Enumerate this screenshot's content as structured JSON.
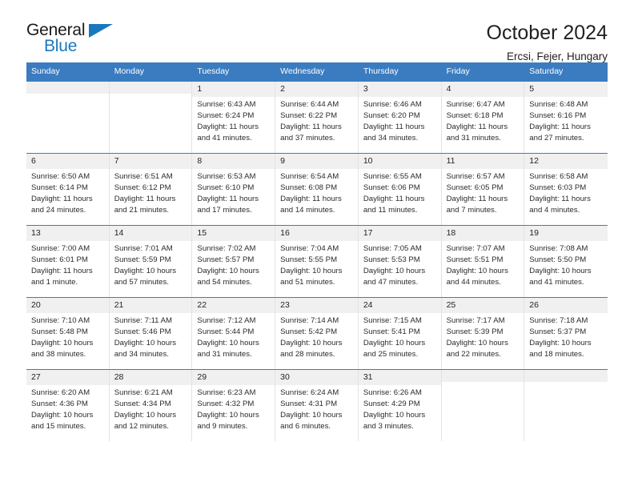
{
  "brand": {
    "name_part1": "General",
    "name_part2": "Blue",
    "flag_icon": "triangle-flag-icon"
  },
  "header": {
    "title": "October 2024",
    "subtitle": "Ercsi, Fejer, Hungary"
  },
  "colors": {
    "header_blue": "#3b7cc0",
    "brand_blue": "#1878be",
    "daynum_band": "#f0f0f0",
    "text": "#231f20"
  },
  "weekday_headers": [
    "Sunday",
    "Monday",
    "Tuesday",
    "Wednesday",
    "Thursday",
    "Friday",
    "Saturday"
  ],
  "weeks": [
    [
      {
        "day": "",
        "sunrise": "",
        "sunset": "",
        "daylight": ""
      },
      {
        "day": "",
        "sunrise": "",
        "sunset": "",
        "daylight": ""
      },
      {
        "day": "1",
        "sunrise": "Sunrise: 6:43 AM",
        "sunset": "Sunset: 6:24 PM",
        "daylight": "Daylight: 11 hours and 41 minutes."
      },
      {
        "day": "2",
        "sunrise": "Sunrise: 6:44 AM",
        "sunset": "Sunset: 6:22 PM",
        "daylight": "Daylight: 11 hours and 37 minutes."
      },
      {
        "day": "3",
        "sunrise": "Sunrise: 6:46 AM",
        "sunset": "Sunset: 6:20 PM",
        "daylight": "Daylight: 11 hours and 34 minutes."
      },
      {
        "day": "4",
        "sunrise": "Sunrise: 6:47 AM",
        "sunset": "Sunset: 6:18 PM",
        "daylight": "Daylight: 11 hours and 31 minutes."
      },
      {
        "day": "5",
        "sunrise": "Sunrise: 6:48 AM",
        "sunset": "Sunset: 6:16 PM",
        "daylight": "Daylight: 11 hours and 27 minutes."
      }
    ],
    [
      {
        "day": "6",
        "sunrise": "Sunrise: 6:50 AM",
        "sunset": "Sunset: 6:14 PM",
        "daylight": "Daylight: 11 hours and 24 minutes."
      },
      {
        "day": "7",
        "sunrise": "Sunrise: 6:51 AM",
        "sunset": "Sunset: 6:12 PM",
        "daylight": "Daylight: 11 hours and 21 minutes."
      },
      {
        "day": "8",
        "sunrise": "Sunrise: 6:53 AM",
        "sunset": "Sunset: 6:10 PM",
        "daylight": "Daylight: 11 hours and 17 minutes."
      },
      {
        "day": "9",
        "sunrise": "Sunrise: 6:54 AM",
        "sunset": "Sunset: 6:08 PM",
        "daylight": "Daylight: 11 hours and 14 minutes."
      },
      {
        "day": "10",
        "sunrise": "Sunrise: 6:55 AM",
        "sunset": "Sunset: 6:06 PM",
        "daylight": "Daylight: 11 hours and 11 minutes."
      },
      {
        "day": "11",
        "sunrise": "Sunrise: 6:57 AM",
        "sunset": "Sunset: 6:05 PM",
        "daylight": "Daylight: 11 hours and 7 minutes."
      },
      {
        "day": "12",
        "sunrise": "Sunrise: 6:58 AM",
        "sunset": "Sunset: 6:03 PM",
        "daylight": "Daylight: 11 hours and 4 minutes."
      }
    ],
    [
      {
        "day": "13",
        "sunrise": "Sunrise: 7:00 AM",
        "sunset": "Sunset: 6:01 PM",
        "daylight": "Daylight: 11 hours and 1 minute."
      },
      {
        "day": "14",
        "sunrise": "Sunrise: 7:01 AM",
        "sunset": "Sunset: 5:59 PM",
        "daylight": "Daylight: 10 hours and 57 minutes."
      },
      {
        "day": "15",
        "sunrise": "Sunrise: 7:02 AM",
        "sunset": "Sunset: 5:57 PM",
        "daylight": "Daylight: 10 hours and 54 minutes."
      },
      {
        "day": "16",
        "sunrise": "Sunrise: 7:04 AM",
        "sunset": "Sunset: 5:55 PM",
        "daylight": "Daylight: 10 hours and 51 minutes."
      },
      {
        "day": "17",
        "sunrise": "Sunrise: 7:05 AM",
        "sunset": "Sunset: 5:53 PM",
        "daylight": "Daylight: 10 hours and 47 minutes."
      },
      {
        "day": "18",
        "sunrise": "Sunrise: 7:07 AM",
        "sunset": "Sunset: 5:51 PM",
        "daylight": "Daylight: 10 hours and 44 minutes."
      },
      {
        "day": "19",
        "sunrise": "Sunrise: 7:08 AM",
        "sunset": "Sunset: 5:50 PM",
        "daylight": "Daylight: 10 hours and 41 minutes."
      }
    ],
    [
      {
        "day": "20",
        "sunrise": "Sunrise: 7:10 AM",
        "sunset": "Sunset: 5:48 PM",
        "daylight": "Daylight: 10 hours and 38 minutes."
      },
      {
        "day": "21",
        "sunrise": "Sunrise: 7:11 AM",
        "sunset": "Sunset: 5:46 PM",
        "daylight": "Daylight: 10 hours and 34 minutes."
      },
      {
        "day": "22",
        "sunrise": "Sunrise: 7:12 AM",
        "sunset": "Sunset: 5:44 PM",
        "daylight": "Daylight: 10 hours and 31 minutes."
      },
      {
        "day": "23",
        "sunrise": "Sunrise: 7:14 AM",
        "sunset": "Sunset: 5:42 PM",
        "daylight": "Daylight: 10 hours and 28 minutes."
      },
      {
        "day": "24",
        "sunrise": "Sunrise: 7:15 AM",
        "sunset": "Sunset: 5:41 PM",
        "daylight": "Daylight: 10 hours and 25 minutes."
      },
      {
        "day": "25",
        "sunrise": "Sunrise: 7:17 AM",
        "sunset": "Sunset: 5:39 PM",
        "daylight": "Daylight: 10 hours and 22 minutes."
      },
      {
        "day": "26",
        "sunrise": "Sunrise: 7:18 AM",
        "sunset": "Sunset: 5:37 PM",
        "daylight": "Daylight: 10 hours and 18 minutes."
      }
    ],
    [
      {
        "day": "27",
        "sunrise": "Sunrise: 6:20 AM",
        "sunset": "Sunset: 4:36 PM",
        "daylight": "Daylight: 10 hours and 15 minutes."
      },
      {
        "day": "28",
        "sunrise": "Sunrise: 6:21 AM",
        "sunset": "Sunset: 4:34 PM",
        "daylight": "Daylight: 10 hours and 12 minutes."
      },
      {
        "day": "29",
        "sunrise": "Sunrise: 6:23 AM",
        "sunset": "Sunset: 4:32 PM",
        "daylight": "Daylight: 10 hours and 9 minutes."
      },
      {
        "day": "30",
        "sunrise": "Sunrise: 6:24 AM",
        "sunset": "Sunset: 4:31 PM",
        "daylight": "Daylight: 10 hours and 6 minutes."
      },
      {
        "day": "31",
        "sunrise": "Sunrise: 6:26 AM",
        "sunset": "Sunset: 4:29 PM",
        "daylight": "Daylight: 10 hours and 3 minutes."
      },
      {
        "day": "",
        "sunrise": "",
        "sunset": "",
        "daylight": ""
      },
      {
        "day": "",
        "sunrise": "",
        "sunset": "",
        "daylight": ""
      }
    ]
  ]
}
